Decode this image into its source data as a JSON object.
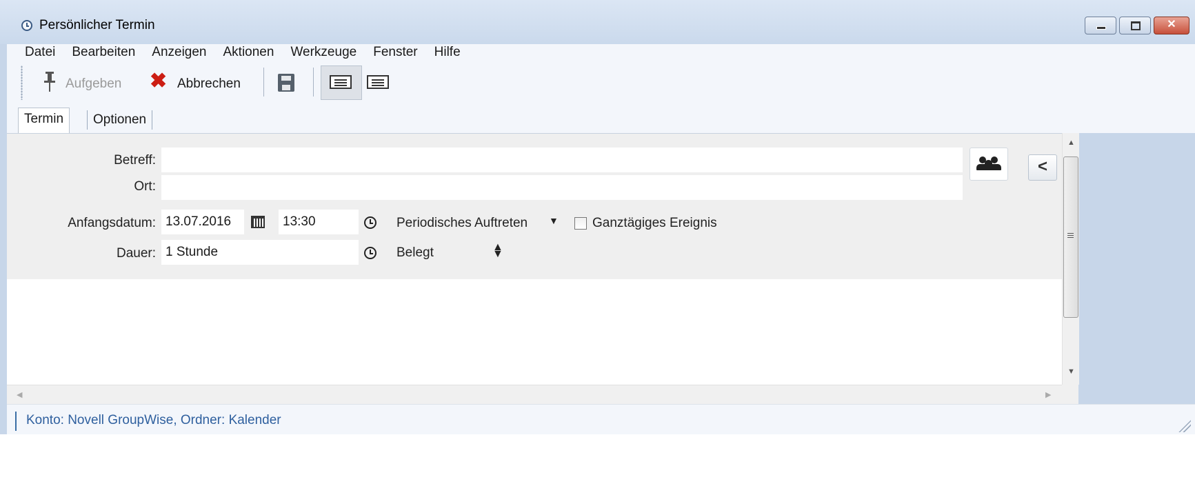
{
  "window": {
    "title": "Persönlicher Termin",
    "controls": {
      "minimize": "minimize",
      "maximize": "maximize",
      "close": "✕"
    }
  },
  "menu": [
    "Datei",
    "Bearbeiten",
    "Anzeigen",
    "Aktionen",
    "Werkzeuge",
    "Fenster",
    "Hilfe"
  ],
  "toolbar": {
    "post_label": "Aufgeben",
    "cancel_label": "Abbrechen",
    "icons": [
      "pin-icon",
      "cancel-x-icon",
      "save-disk-icon",
      "view-form-icon",
      "view-text-icon"
    ]
  },
  "tabs": [
    {
      "label": "Termin",
      "active": true
    },
    {
      "label": "Optionen",
      "active": false
    }
  ],
  "form": {
    "subject_label": "Betreff:",
    "subject_value": "",
    "location_label": "Ort:",
    "location_value": "",
    "start_label": "Anfangsdatum:",
    "start_date": "13.07.2016",
    "start_time": "13:30",
    "recurrence_label": "Periodisches Auftreten",
    "allday_label": "Ganztägiges Ereignis",
    "allday_checked": false,
    "duration_label": "Dauer:",
    "duration_value": "1 Stunde",
    "show_as_value": "Belegt",
    "collapse_glyph": "<"
  },
  "status": {
    "text": "Konto: Novell GroupWise,  Ordner: Kalender"
  },
  "colors": {
    "frame": "#c7d6e9",
    "bar_bg": "#f3f6fb",
    "form_bg": "#efefef",
    "cancel_red": "#cc1e14",
    "status_text": "#2e5f9e"
  }
}
